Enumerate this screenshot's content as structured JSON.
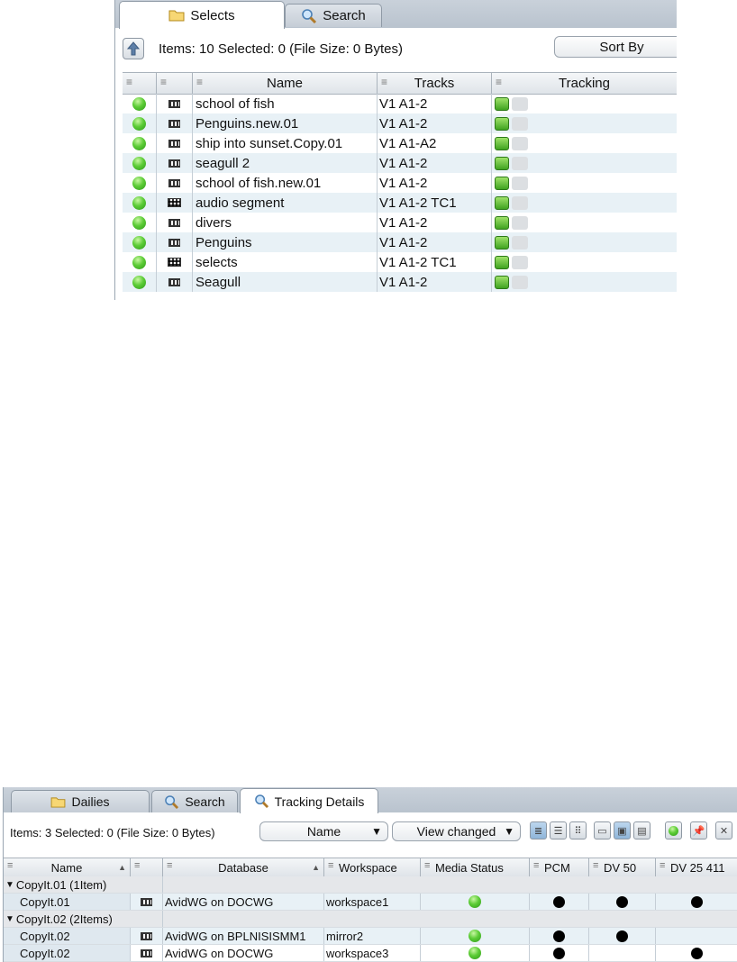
{
  "panel1": {
    "tabs": [
      {
        "label": "Selects",
        "icon": "folder-icon",
        "active": true
      },
      {
        "label": "Search",
        "icon": "search-icon",
        "active": false
      }
    ],
    "items_status": "Items: 10 Selected: 0 (File Size: 0 Bytes)",
    "sort_by_label": "Sort By",
    "columns": [
      "",
      "",
      "Name",
      "Tracks",
      "Tracking"
    ],
    "rows": [
      {
        "name": "school of fish",
        "tracks": "V1 A1-2",
        "type": "clip"
      },
      {
        "name": "Penguins.new.01",
        "tracks": "V1 A1-2",
        "type": "clip"
      },
      {
        "name": "ship into sunset.Copy.01",
        "tracks": "V1 A1-A2",
        "type": "clip"
      },
      {
        "name": "seagull 2",
        "tracks": "V1 A1-2",
        "type": "clip"
      },
      {
        "name": "school of fish.new.01",
        "tracks": "V1 A1-2",
        "type": "clip"
      },
      {
        "name": "audio segment",
        "tracks": "V1 A1-2 TC1",
        "type": "sequence"
      },
      {
        "name": "divers",
        "tracks": "V1 A1-2",
        "type": "clip"
      },
      {
        "name": "Penguins",
        "tracks": "V1 A1-2",
        "type": "clip"
      },
      {
        "name": "selects",
        "tracks": "V1 A1-2 TC1",
        "type": "sequence"
      },
      {
        "name": "Seagull",
        "tracks": "V1 A1-2",
        "type": "clip"
      }
    ]
  },
  "panel2": {
    "tabs": [
      {
        "label": "Dailies",
        "icon": "folder-icon",
        "active": false
      },
      {
        "label": "Search",
        "icon": "search-icon",
        "active": false
      },
      {
        "label": "Tracking Details",
        "icon": "search-icon",
        "active": true
      }
    ],
    "items_status": "Items: 3 Selected: 0 (File Size: 0 Bytes)",
    "name_dropdown": "Name",
    "view_dropdown": "View changed",
    "columns": [
      "Name",
      "",
      "Database",
      "Workspace",
      "Media Status",
      "PCM",
      "DV 50",
      "DV 25 411"
    ],
    "groups": [
      {
        "label": "CopyIt.01 (1Item)",
        "rows": [
          {
            "name": "CopyIt.01",
            "database": "AvidWG on DOCWG",
            "workspace": "workspace1",
            "pcm": true,
            "dv50": true,
            "dv25": true
          }
        ]
      },
      {
        "label": "CopyIt.02 (2Items)",
        "rows": [
          {
            "name": "CopyIt.02",
            "database": "AvidWG on BPLNISISMM1",
            "workspace": "mirror2",
            "pcm": true,
            "dv50": true,
            "dv25": false
          },
          {
            "name": "CopyIt.02",
            "database": "AvidWG on DOCWG",
            "workspace": "workspace3",
            "pcm": true,
            "dv50": false,
            "dv25": true
          }
        ]
      }
    ]
  }
}
